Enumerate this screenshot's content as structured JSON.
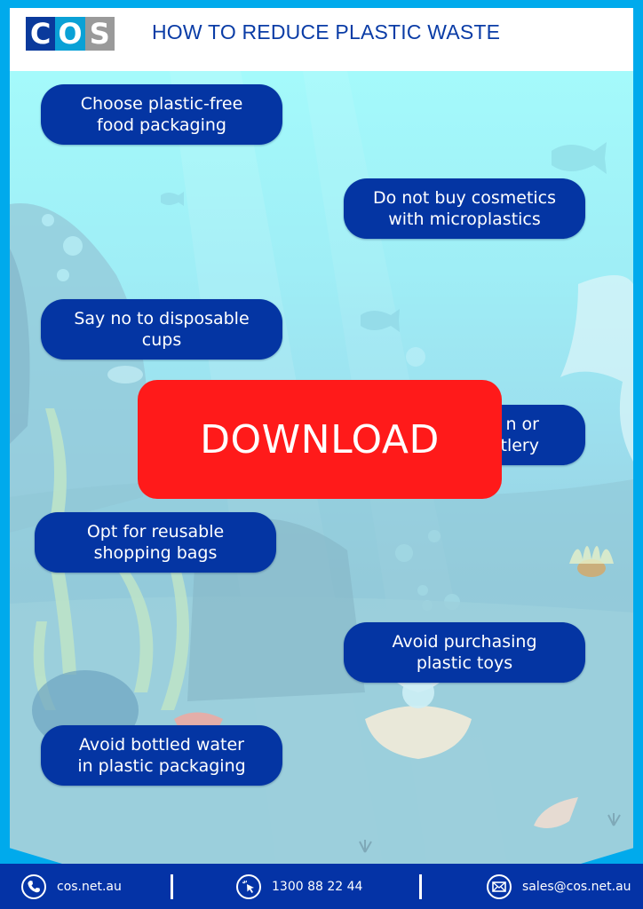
{
  "header": {
    "logo_letters": [
      "C",
      "O",
      "S"
    ],
    "title": "HOW TO REDUCE PLASTIC WASTE"
  },
  "tips": [
    {
      "line1": "Choose  plastic-free",
      "line2": "food packaging"
    },
    {
      "line1": "Do not buy cosmetics",
      "line2": "with microplastics"
    },
    {
      "line1": "Say no to disposable",
      "line2": "cups"
    },
    {
      "line1": "n or",
      "line2": "tlery"
    },
    {
      "line1": "Opt for reusable",
      "line2": "shopping bags"
    },
    {
      "line1": "Avoid purchasing",
      "line2": "plastic toys"
    },
    {
      "line1": "Avoid bottled water",
      "line2": "in plastic packaging"
    }
  ],
  "download": {
    "label": "DOWNLOAD"
  },
  "footer": {
    "website": {
      "icon": "phone-icon",
      "text": "cos.net.au"
    },
    "phone": {
      "icon": "cursor-click-icon",
      "text": "1300 88 22 44"
    },
    "email": {
      "icon": "envelope-icon",
      "text": "sales@cos.net.au"
    }
  },
  "colors": {
    "frame": "#00aaec",
    "pill": "#0435a3",
    "download": "#ff1a1a",
    "footer": "#0433a6",
    "title": "#0a3ca6"
  }
}
